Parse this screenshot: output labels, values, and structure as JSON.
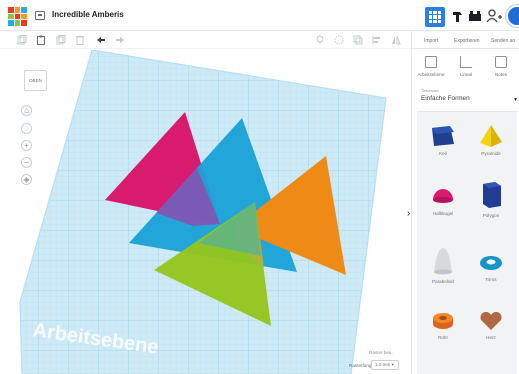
{
  "app": {
    "title": "Incredible Amberis"
  },
  "header": {
    "right_tabs": [
      "Import",
      "Exportieren",
      "Senden an"
    ]
  },
  "tools": [
    {
      "label": "Arbeitsebene"
    },
    {
      "label": "Lineal"
    },
    {
      "label": "Notes"
    }
  ],
  "library": {
    "label": "Tinkercad",
    "selected": "Einfache Formen"
  },
  "shapes": [
    {
      "name": "Keil",
      "color": "#1f3f8f"
    },
    {
      "name": "Pyramide",
      "color": "#f3d21a"
    },
    {
      "name": "Halbkugel",
      "color": "#d81b6f"
    },
    {
      "name": "Polygon",
      "color": "#233d95"
    },
    {
      "name": "Paraboloid",
      "color": "#d7d9dc"
    },
    {
      "name": "Torus",
      "color": "#1794c9"
    },
    {
      "name": "Rohr",
      "color": "#e67624"
    },
    {
      "name": "Herz",
      "color": "#b06a43"
    }
  ],
  "workplane": {
    "label": "Arbeitsebene",
    "view_cube": "OBEN",
    "edit_grid": "Raster bea.",
    "snap_label": "Rasterfang",
    "snap_value": "1.0 mm ▾",
    "grid_color": "#cfeaf7"
  }
}
